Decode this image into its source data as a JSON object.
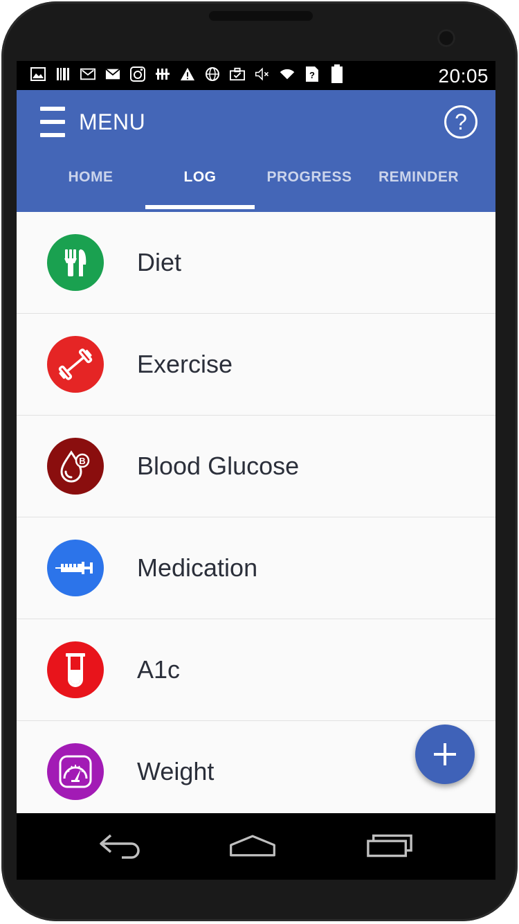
{
  "status_bar": {
    "icons": [
      "image-icon",
      "barcode-icon",
      "gmail-icon",
      "mail-icon",
      "instagram-icon",
      "grid-icon",
      "warning-icon",
      "globe-icon",
      "briefcase-icon",
      "mute-icon",
      "wifi-icon",
      "sim-icon",
      "battery-icon"
    ],
    "time": "20:05"
  },
  "app_bar": {
    "menu_label": "MENU",
    "help_label": "?",
    "color": "#4466b7"
  },
  "tabs": [
    {
      "label": "HOME",
      "active": false
    },
    {
      "label": "LOG",
      "active": true
    },
    {
      "label": "PROGRESS",
      "active": false
    },
    {
      "label": "REMINDER",
      "active": false
    }
  ],
  "log_items": [
    {
      "label": "Diet",
      "icon": "fork-knife-icon",
      "color": "#1aa150"
    },
    {
      "label": "Exercise",
      "icon": "dumbbell-icon",
      "color": "#e52525"
    },
    {
      "label": "Blood Glucose",
      "icon": "blood-drop-icon",
      "color": "#8a0e0e"
    },
    {
      "label": "Medication",
      "icon": "syringe-icon",
      "color": "#2c74ea"
    },
    {
      "label": "A1c",
      "icon": "test-tube-icon",
      "color": "#e8141b"
    },
    {
      "label": "Weight",
      "icon": "scale-gauge-icon",
      "color": "#a21bb5"
    }
  ],
  "fab": {
    "icon": "plus-icon",
    "color": "#3f62b8"
  },
  "nav_bar": {
    "buttons": [
      "back-icon",
      "home-icon",
      "recents-icon"
    ]
  }
}
